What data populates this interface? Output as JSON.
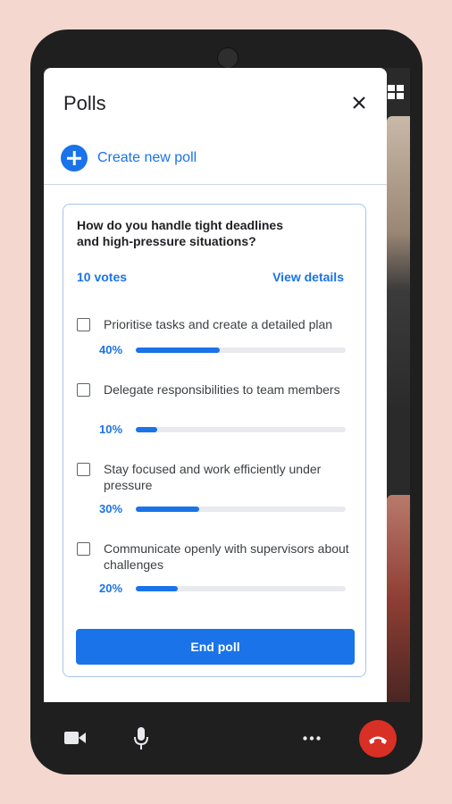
{
  "panel": {
    "title": "Polls",
    "create_label": "Create new poll"
  },
  "poll": {
    "question_line1": "How do you handle tight deadlines",
    "question_line2": "and high-pressure situations?",
    "votes": "10 votes",
    "view_details": "View details",
    "options": [
      {
        "label": "Prioritise tasks and create a detailed plan",
        "percent_label": "40%",
        "percent": 40
      },
      {
        "label": "Delegate responsibilities to team members",
        "percent_label": "10%",
        "percent": 10
      },
      {
        "label": "Stay focused and work efficiently under pressure",
        "percent_label": "30%",
        "percent": 30
      },
      {
        "label": "Communicate openly with supervisors about challenges",
        "percent_label": "20%",
        "percent": 20
      }
    ],
    "end_button": "End poll"
  },
  "controls": [
    "camera-icon",
    "microphone-icon",
    "more-options-icon",
    "hang-up-icon"
  ],
  "colors": {
    "accent": "#1a73e8",
    "hangup": "#d93025",
    "background": "#f4d8d0"
  }
}
